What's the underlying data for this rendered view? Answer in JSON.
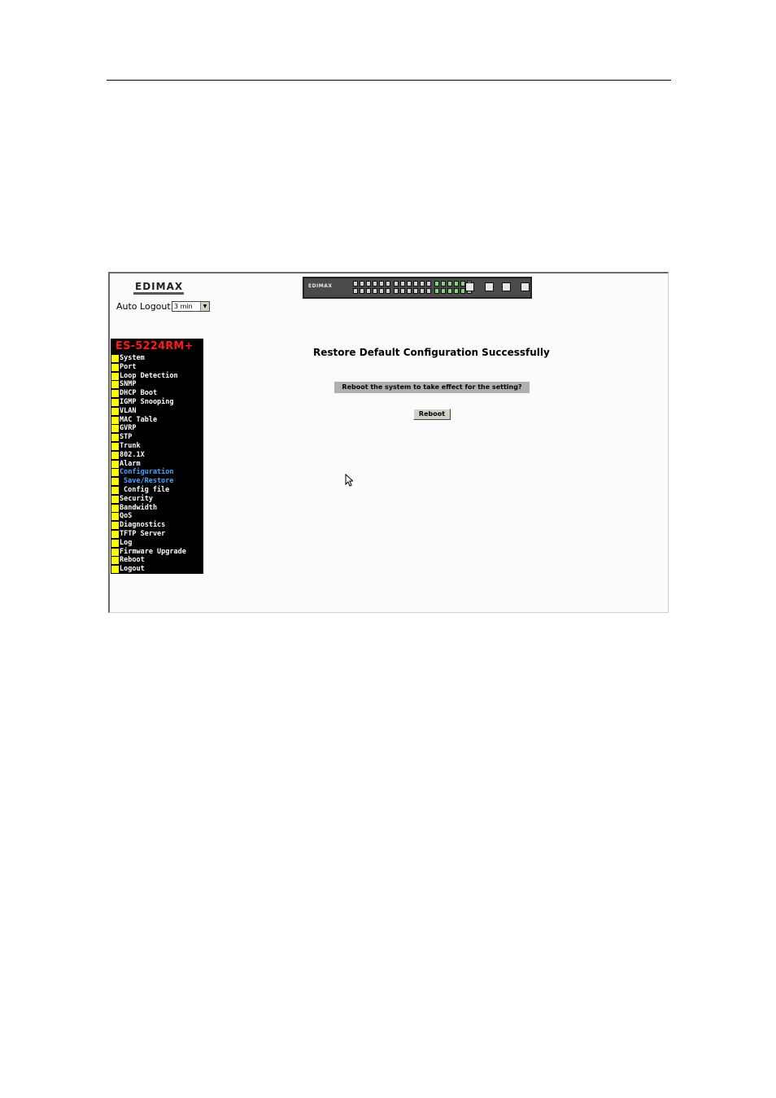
{
  "brand": {
    "logo_text": "EDIMAX",
    "device_brand": "EDIMAX"
  },
  "header": {
    "auto_logout_label": "Auto Logout",
    "auto_logout_value": "3 min"
  },
  "sidebar": {
    "model": "ES-5224RM+",
    "items": [
      {
        "label": "System"
      },
      {
        "label": "Port"
      },
      {
        "label": "Loop Detection"
      },
      {
        "label": "SNMP"
      },
      {
        "label": "DHCP Boot"
      },
      {
        "label": "IGMP Snooping"
      },
      {
        "label": "VLAN"
      },
      {
        "label": "MAC Table"
      },
      {
        "label": "GVRP"
      },
      {
        "label": "STP"
      },
      {
        "label": "Trunk"
      },
      {
        "label": "802.1X"
      },
      {
        "label": "Alarm"
      },
      {
        "label": "Configuration"
      },
      {
        "label": "Save/Restore"
      },
      {
        "label": "Config file"
      },
      {
        "label": "Security"
      },
      {
        "label": "Bandwidth"
      },
      {
        "label": "QoS"
      },
      {
        "label": "Diagnostics"
      },
      {
        "label": "TFTP Server"
      },
      {
        "label": "Log"
      },
      {
        "label": "Firmware Upgrade"
      },
      {
        "label": "Reboot"
      },
      {
        "label": "Logout"
      }
    ]
  },
  "main": {
    "title": "Restore Default Configuration Successfully",
    "prompt": "Reboot the system to take effect for the setting?",
    "reboot_label": "Reboot"
  },
  "colors": {
    "menu_bg": "#000000",
    "model_red": "#ff1a1a",
    "bullet_yellow": "#ffff00",
    "active_blue": "#4aa3ff"
  }
}
